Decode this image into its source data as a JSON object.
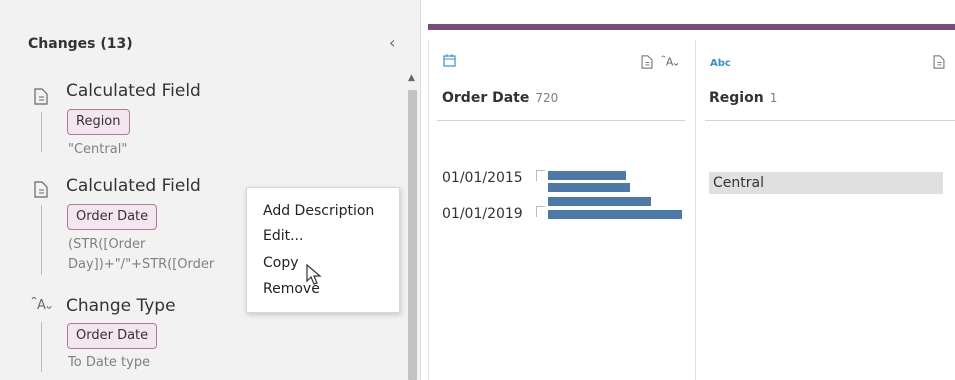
{
  "changes": {
    "header": "Changes (13)",
    "items": [
      {
        "icon": "calculated-field-icon",
        "title": "Calculated Field",
        "field": "Region",
        "detail_lines": [
          "\"Central\""
        ]
      },
      {
        "icon": "calculated-field-icon",
        "title": "Calculated Field",
        "field": "Order Date",
        "detail_lines": [
          "(STR([Order",
          "Day])+\"/\"+STR([Order"
        ]
      },
      {
        "icon": "change-type-icon",
        "title": "Change Type",
        "field": "Order Date",
        "detail_lines": [
          "To Date type"
        ]
      }
    ]
  },
  "context_menu": {
    "items": [
      "Add Description",
      "Edit...",
      "Copy",
      "Remove"
    ]
  },
  "columns": [
    {
      "type_icon": "calendar-icon",
      "name": "Order Date",
      "count": "720",
      "axis_labels": [
        "01/01/2015",
        "01/01/2019"
      ],
      "bars": [
        0.58,
        0.61,
        0.77,
        1.0
      ]
    },
    {
      "type_icon": "string-type-icon",
      "type_text": "Abc",
      "name": "Region",
      "count": "1",
      "values": [
        "Central"
      ]
    }
  ],
  "colors": {
    "accent_bar": "#7d4a79",
    "bar_fill": "#4e79a7",
    "pill_bg": "#f3e6ef",
    "pill_border": "#b07a9b"
  }
}
